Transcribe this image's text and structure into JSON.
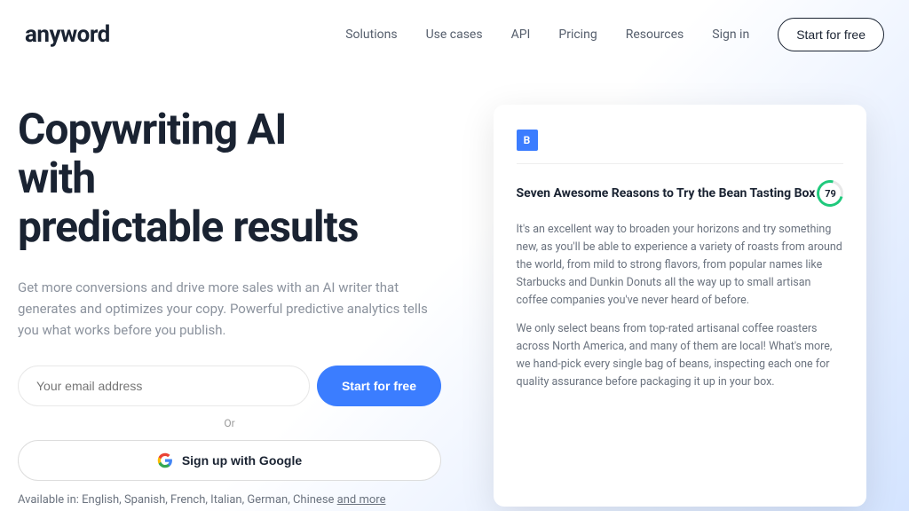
{
  "nav": {
    "logo": "anyword",
    "items": [
      "Solutions",
      "Use cases",
      "API",
      "Pricing",
      "Resources",
      "Sign in"
    ],
    "cta": "Start for free"
  },
  "hero": {
    "headline_line1": "Copywriting AI",
    "headline_line2": "with",
    "headline_line3": "predictable results",
    "subtext": "Get more conversions and drive more sales with an AI writer that generates and optimizes your copy. Powerful predictive analytics tells you what works before you publish.",
    "email_placeholder": "Your email address",
    "start_btn": "Start for free",
    "or_text": "Or",
    "google_btn": "Sign up with Google",
    "languages_prefix": "Available in: English, Spanish, French, Italian, German, Chinese ",
    "languages_more": "and more"
  },
  "card": {
    "icon_label": "B",
    "title": "Seven Awesome Reasons to Try the Bean Tasting Box",
    "score": "79",
    "para1": "It's an excellent way to broaden your horizons and try something new, as you'll be able to experience a variety of roasts from around the world, from mild to strong flavors, from popular names like Starbucks and Dunkin Donuts all the way up to small artisan coffee companies you've never heard of before.",
    "para2": "We only select beans from top-rated artisanal coffee roasters across North America, and many of them are local! What's more, we hand-pick every single bag of beans, inspecting each one for quality assurance before packaging it up in your box."
  }
}
